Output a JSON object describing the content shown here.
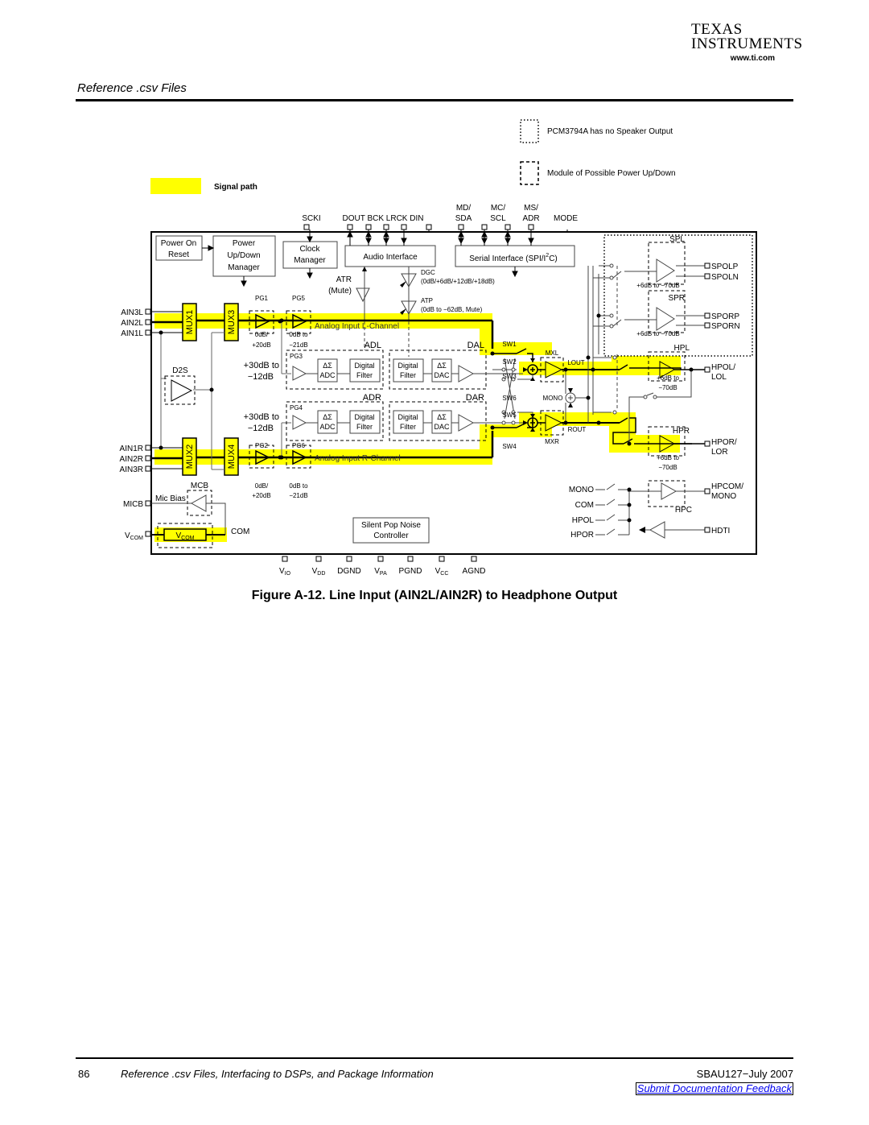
{
  "header": {
    "section_title": "Reference .csv Files",
    "logo": {
      "line1": "TEXAS",
      "line2": "INSTRUMENTS",
      "url": "www.ti.com"
    }
  },
  "legend": {
    "dotted_box": "PCM3794A has no Speaker Output",
    "dashed_box": "Module of Possible Power Up/Down",
    "signal_path": "Signal path",
    "signal_color": "#ffff00"
  },
  "diagram": {
    "top_pins": {
      "scki": "SCKI",
      "dout_bck_lrck_din": "DOUT BCK LRCK  DIN",
      "md": "MD/",
      "sda": "SDA",
      "mc": "MC/",
      "scl": "SCL",
      "ms": "MS/",
      "adr": "ADR",
      "mode": "MODE"
    },
    "blocks": {
      "por1": "Power On",
      "por2": "Reset",
      "pud1": "Power",
      "pud2": "Up/Down",
      "pud3": "Manager",
      "clk1": "Clock",
      "clk2": "Manager",
      "audio_if": "Audio Interface",
      "serial_if": "Serial Interface (SPI/I",
      "serial_if_sup": "2",
      "serial_if_end": "C)",
      "atr1": "ATR",
      "atr2": "(Mute)",
      "dgc": "DGC",
      "dgc_range": "(0dB/+6dB/+12dB/+18dB)",
      "atp": "ATP",
      "atp_range": "(0dB to −62dB, Mute)",
      "mux1": "MUX1",
      "mux2": "MUX2",
      "mux3": "MUX3",
      "mux4": "MUX4",
      "pg1": "PG1",
      "pg2": "PG2",
      "pg3": "PG3",
      "pg4": "PG4",
      "pg5": "PG5",
      "pg6": "PG6",
      "pg1_r1": "0dB/",
      "pg1_r2": "+20dB",
      "pg5_r1": "0dB to",
      "pg5_r2": "−21dB",
      "pg3_r1": "+30dB to",
      "pg3_r2": "−12dB",
      "d2s": "D2S",
      "analog_l": "Analog Input L-Channel",
      "analog_r": "Analog Input R-Channel",
      "adl": "ADL",
      "adr": "ADR",
      "dal": "DAL",
      "dar": "DAR",
      "ds": "ΔΣ",
      "adc": "ADC",
      "dac": "DAC",
      "digital": "Digital",
      "filter": "Filter",
      "sw1": "SW1",
      "sw2": "SW2",
      "sw3": "SW3",
      "sw4": "SW4",
      "sw5": "SW5",
      "sw6": "SW6",
      "mxl": "MXL",
      "mxr": "MXR",
      "lout": "LOUT",
      "rout": "ROUT",
      "mono": "MONO",
      "spl": "SPL",
      "spr": "SPR",
      "hpl": "HPL",
      "hpr": "HPR",
      "hpc": "HPC",
      "sp_range": "+6dB to −70dB",
      "hp_r1": "+6dB to",
      "hp_r2": "−70dB",
      "mcb": "MCB",
      "mic_bias": "Mic Bias",
      "vcom": "V",
      "vcom_sub": "COM",
      "com": "COM",
      "spn1": "Silent Pop Noise",
      "spn2": "Controller",
      "hpc_in_mono": "MONO",
      "hpc_in_com": "COM",
      "hpc_in_hpol": "HPOL",
      "hpc_in_hpor": "HPOR"
    },
    "left_pins": [
      "AIN3L",
      "AIN2L",
      "AIN1L",
      "AIN1R",
      "AIN2R",
      "AIN3R",
      "MICB"
    ],
    "right_pins": {
      "spolp": "SPOLP",
      "spoln": "SPOLN",
      "sporp": "SPORP",
      "sporn": "SPORN",
      "hpol1": "HPOL/",
      "hpol2": "LOL",
      "hpor1": "HPOR/",
      "hpor2": "LOR",
      "hpcom1": "HPCOM/",
      "hpcom2": "MONO",
      "hdti": "HDTI"
    },
    "bottom_pins": {
      "vio": "V",
      "vio_sub": "IO",
      "vdd": "V",
      "vdd_sub": "DD",
      "dgnd": "DGND",
      "vpa": "V",
      "vpa_sub": "PA",
      "pgnd": "PGND",
      "vcc": "V",
      "vcc_sub": "CC",
      "agnd": "AGND"
    }
  },
  "caption": "Figure A-12. Line Input (AIN2L/AIN2R) to Headphone Output",
  "footer": {
    "page": "86",
    "title": "Reference .csv Files, Interfacing to DSPs, and Package Information",
    "doc_id": "SBAU127−July 2007",
    "feedback_link": "Submit Documentation Feedback"
  }
}
